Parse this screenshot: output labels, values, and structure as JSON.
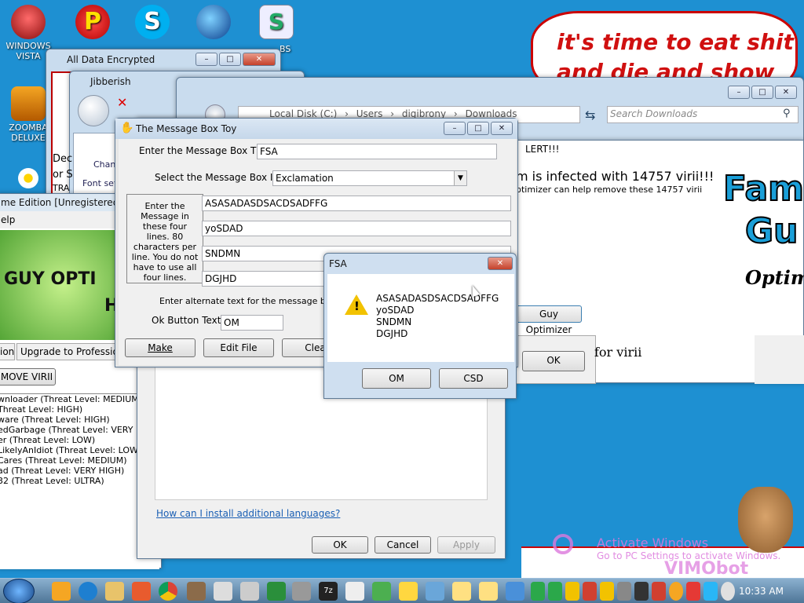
{
  "desktop": {
    "icons": [
      {
        "label": "WINDOWS VISTA",
        "color": "#c43030"
      },
      {
        "label": "ZOOMBA DELUXE",
        "color": "#e08a10"
      }
    ],
    "bubble_line1": "it's time to eat shit",
    "bubble_line2": "and die and show"
  },
  "windows": {
    "all_data_encrypted": {
      "title": "All Data Encrypted"
    },
    "jibberish": {
      "title": "Jibberish",
      "frag1": "Dec",
      "frag2": "or S",
      "frag3": "TRA",
      "change_label": "Chan",
      "font_label": "Font set"
    },
    "explorer": {
      "path": [
        "Local Disk (C:)",
        "Users",
        "digibrony",
        "Downloads"
      ],
      "search_placeholder": "Search Downloads"
    },
    "alert": {
      "title_fragment": "LERT!!!",
      "infected_text": "m is infected with 14757 virii!!!",
      "sub_text": "ptimizer can help remove these 14757 virii",
      "logo1": "Fami",
      "logo2": "Gu",
      "logo3": "Optimi",
      "guy_btn": "Guy Optimizer",
      "ok_btn": "OK",
      "for_virii": "for virii"
    },
    "optimizer": {
      "title": "me Edition [Unregistered]",
      "menu": "elp",
      "banner1": "GUY OPTI",
      "banner2": "H",
      "tab1": "ion",
      "tab2": "Upgrade to Professional!!!",
      "remove_btn": "MOVE VIRII",
      "threats": [
        "wnloader (Threat Level: MEDIUM)",
        "Threat Level: HIGH)",
        "ware (Threat Level: HIGH)",
        "edGarbage (Threat Level: VERY HIGH)",
        "er (Threat Level: LOW)",
        "LikelyAnIdiot (Threat Level: LOW)",
        "Cares (Threat Level: MEDIUM)",
        "ad (Threat Level: VERY HIGH)",
        "32 (Threat Level: ULTRA)"
      ]
    },
    "language": {
      "link": "How can I install additional languages?",
      "ok": "OK",
      "cancel": "Cancel",
      "apply": "Apply"
    },
    "message_box_toy": {
      "title": "The Message Box Toy",
      "title_label": "Enter the Message Box Title:",
      "title_value": "FSA",
      "icon_label": "Select the Message Box Icon:",
      "icon_value": "Exclamation",
      "lines_help": "Enter the Message in these four lines. 80 characters per line.  You do not have to use all four lines.",
      "lines": [
        "ASASADASDSACDSADFFG",
        "yoSDAD",
        "SNDMN",
        "DGJHD"
      ],
      "alt_label": "Enter alternate text for the message box butt",
      "ok_label": "Ok Button Text:",
      "ok_value": "OM",
      "make_btn": "Make",
      "edit_btn": "Edit File",
      "clear_btn": "Clear"
    },
    "fsa_dialog": {
      "title": "FSA",
      "lines": [
        "ASASADASDSACDSADFFG",
        "yoSDAD",
        "SNDMN",
        "DGJHD"
      ],
      "btn1": "OM",
      "btn2": "CSD"
    }
  },
  "watermark": {
    "line1": "Activate Windows",
    "line2": "Go to PC Settings to activate Windows.",
    "brand": "VIMObot"
  },
  "taskbar": {
    "clock": "10:33 AM",
    "seven_zip": "7z"
  }
}
